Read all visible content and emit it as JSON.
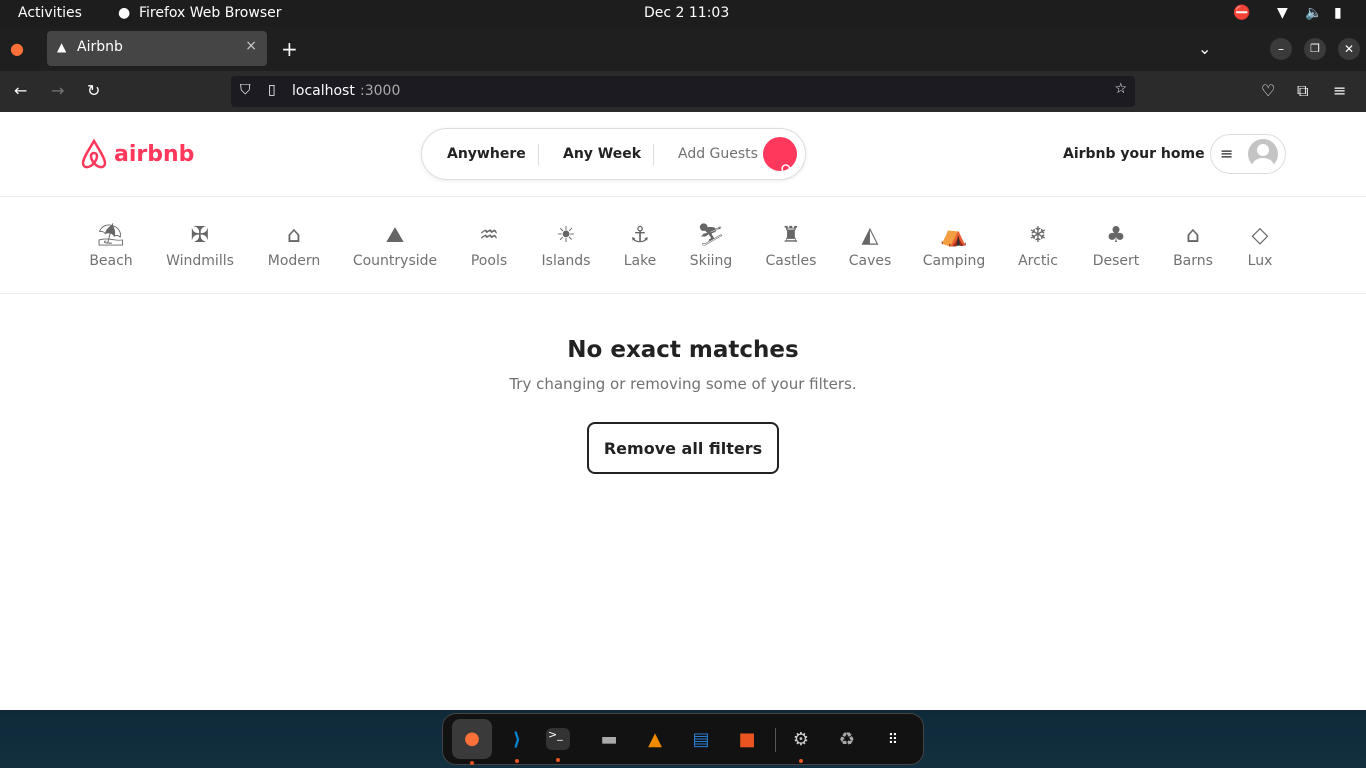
{
  "system": {
    "activities": "Activities",
    "app_name": "Firefox Web Browser",
    "clock": "Dec 2  11:03"
  },
  "browser": {
    "tab_title": "Airbnb",
    "url_host": "localhost",
    "url_port": ":3000"
  },
  "header": {
    "logo": "airbnb",
    "search": {
      "where": "Anywhere",
      "when": "Any Week",
      "guests": "Add Guests"
    },
    "host_link": "Airbnb your home"
  },
  "categories": [
    {
      "label": "Beach",
      "icon": "⛱"
    },
    {
      "label": "Windmills",
      "icon": "✠"
    },
    {
      "label": "Modern",
      "icon": "⌂"
    },
    {
      "label": "Countryside",
      "icon": "⛰"
    },
    {
      "label": "Pools",
      "icon": "♒"
    },
    {
      "label": "Islands",
      "icon": "☀"
    },
    {
      "label": "Lake",
      "icon": "⚓"
    },
    {
      "label": "Skiing",
      "icon": "⛷"
    },
    {
      "label": "Castles",
      "icon": "♜"
    },
    {
      "label": "Caves",
      "icon": "◭"
    },
    {
      "label": "Camping",
      "icon": "⛺"
    },
    {
      "label": "Arctic",
      "icon": "❄"
    },
    {
      "label": "Desert",
      "icon": "♣"
    },
    {
      "label": "Barns",
      "icon": "⌂"
    },
    {
      "label": "Lux",
      "icon": "◇"
    }
  ],
  "empty": {
    "title": "No exact matches",
    "subtitle": "Try changing or removing some of your filters.",
    "button": "Remove all filters"
  },
  "colors": {
    "brand": "#ff385c"
  }
}
